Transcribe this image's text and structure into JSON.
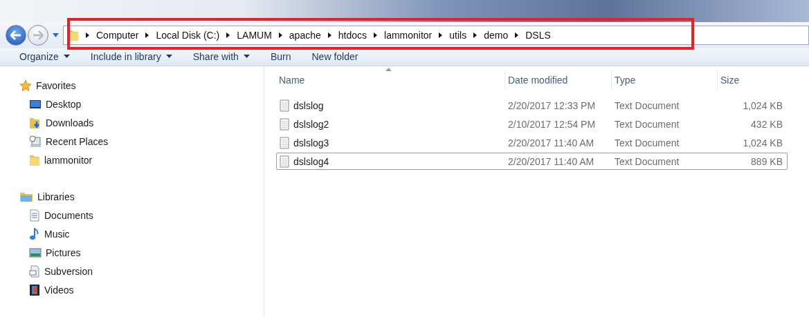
{
  "breadcrumb": [
    "Computer",
    "Local Disk (C:)",
    "LAMUM",
    "apache",
    "htdocs",
    "lammonitor",
    "utils",
    "demo",
    "DSLS"
  ],
  "toolbar": [
    {
      "label": "Organize",
      "dropdown": true
    },
    {
      "label": "Include in library",
      "dropdown": true
    },
    {
      "label": "Share with",
      "dropdown": true
    },
    {
      "label": "Burn",
      "dropdown": false
    },
    {
      "label": "New folder",
      "dropdown": false
    }
  ],
  "sidebar": [
    {
      "label": "Favorites",
      "kind": "star",
      "children": [
        {
          "label": "Desktop",
          "kind": "desktop"
        },
        {
          "label": "Downloads",
          "kind": "downloads"
        },
        {
          "label": "Recent Places",
          "kind": "recent"
        },
        {
          "label": "lammonitor",
          "kind": "folder"
        }
      ]
    },
    {
      "label": "Libraries",
      "kind": "library",
      "children": [
        {
          "label": "Documents",
          "kind": "documents"
        },
        {
          "label": "Music",
          "kind": "music"
        },
        {
          "label": "Pictures",
          "kind": "pictures"
        },
        {
          "label": "Subversion",
          "kind": "subversion"
        },
        {
          "label": "Videos",
          "kind": "videos"
        }
      ]
    }
  ],
  "table": {
    "columns": [
      "Name",
      "Date modified",
      "Type",
      "Size"
    ],
    "rows": [
      {
        "name": "dslslog",
        "date": "2/20/2017 12:33 PM",
        "type": "Text Document",
        "size": "1,024 KB",
        "focused": false
      },
      {
        "name": "dslslog2",
        "date": "2/10/2017 12:54 PM",
        "type": "Text Document",
        "size": "432 KB",
        "focused": false
      },
      {
        "name": "dslslog3",
        "date": "2/20/2017 11:40 AM",
        "type": "Text Document",
        "size": "1,024 KB",
        "focused": false
      },
      {
        "name": "dslslog4",
        "date": "2/20/2017 11:40 AM",
        "type": "Text Document",
        "size": "889 KB",
        "focused": true
      }
    ]
  }
}
